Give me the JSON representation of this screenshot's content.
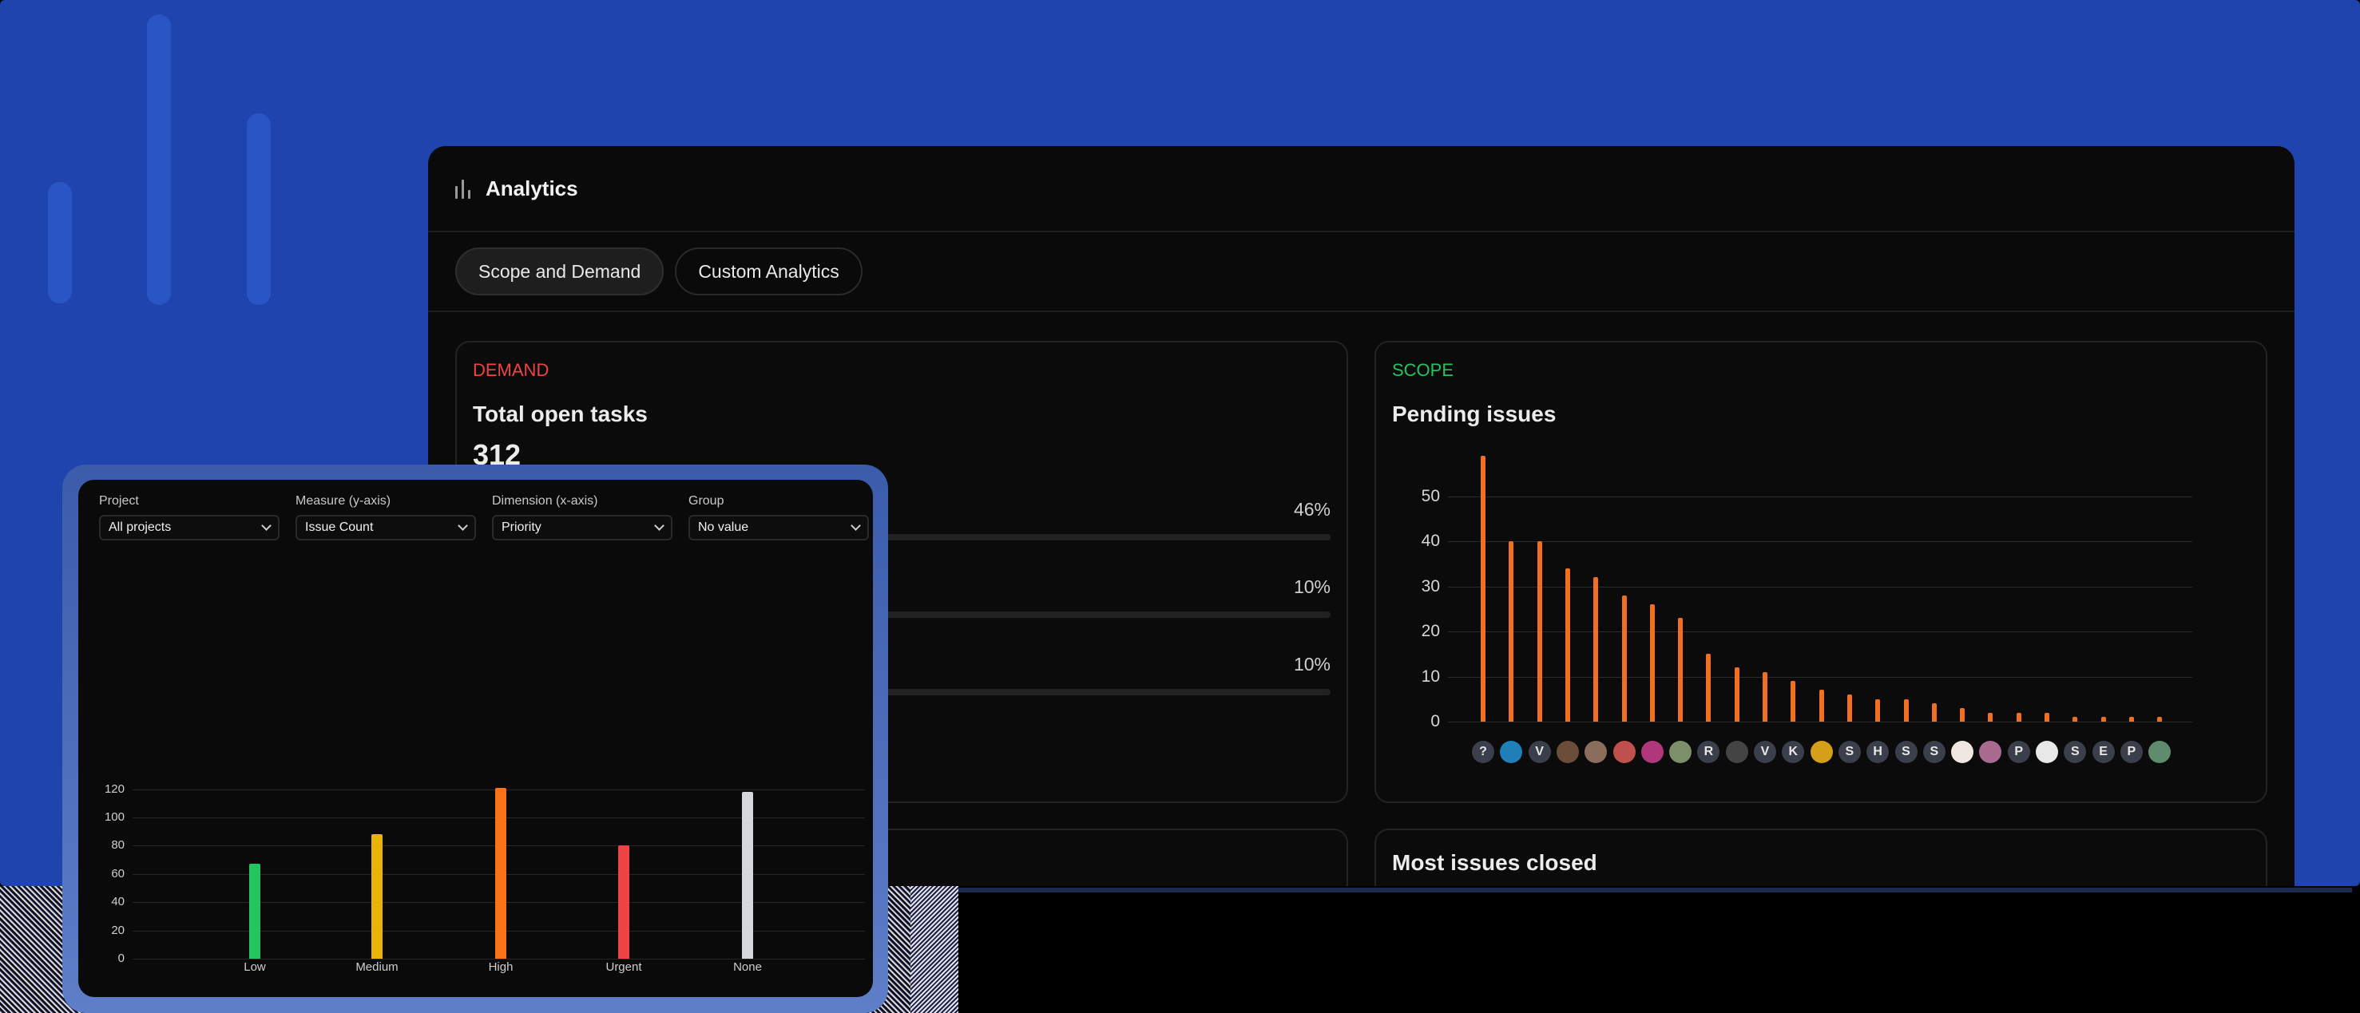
{
  "app": {
    "title": "Analytics"
  },
  "tabs": [
    {
      "label": "Scope and Demand",
      "active": true
    },
    {
      "label": "Custom Analytics",
      "active": false
    }
  ],
  "demand": {
    "tag": "DEMAND",
    "tag_color": "#ef4444",
    "title": "Total open tasks",
    "total": "312",
    "rows": [
      {
        "percent": "46%"
      },
      {
        "percent": "10%"
      },
      {
        "percent": "10%"
      }
    ]
  },
  "scope": {
    "tag": "SCOPE",
    "tag_color": "#22c55e",
    "title": "Pending issues",
    "bar_color": "#f0701f"
  },
  "closed": {
    "title": "Most issues closed"
  },
  "custom": {
    "filters": [
      {
        "label": "Project",
        "value": "All projects"
      },
      {
        "label": "Measure (y-axis)",
        "value": "Issue Count"
      },
      {
        "label": "Dimension (x-axis)",
        "value": "Priority"
      },
      {
        "label": "Group",
        "value": "No value"
      }
    ]
  },
  "chart_data": [
    {
      "type": "bar",
      "title": "Pending issues",
      "ylim": [
        0,
        55
      ],
      "yticks": [
        0,
        10,
        20,
        30,
        40,
        50
      ],
      "categories": [
        "?",
        "avatar",
        "V",
        "avatar",
        "avatar",
        "avatar",
        "avatar",
        "avatar",
        "R",
        "avatar",
        "V",
        "K",
        "avatar",
        "S",
        "H",
        "S",
        "S",
        "avatar",
        "avatar",
        "P",
        "avatar",
        "S",
        "E",
        "P",
        "avatar"
      ],
      "values": [
        59,
        40,
        40,
        34,
        32,
        28,
        26,
        23,
        15,
        12,
        11,
        9,
        7,
        6,
        5,
        5,
        4,
        3,
        2,
        2,
        2,
        1,
        1,
        1,
        1
      ],
      "avatar_colors": [
        "#3a3f4b",
        "#1f7fb8",
        "#3a3f4b",
        "#6b4e3a",
        "#8a6d5a",
        "#c0504d",
        "#b0387a",
        "#7d8f6a",
        "#3a3f4b",
        "#444444",
        "#3a3f4b",
        "#3a3f4b",
        "#d4a017",
        "#3a3f4b",
        "#3a3f4b",
        "#3a3f4b",
        "#3a3f4b",
        "#efe7e0",
        "#a86b8f",
        "#3a3f4b",
        "#e8e8e8",
        "#3a3f4b",
        "#3a3f4b",
        "#3a3f4b",
        "#5e8a6e"
      ]
    },
    {
      "type": "bar",
      "title": "",
      "xlabel": "",
      "ylabel": "",
      "ylim": [
        0,
        125
      ],
      "yticks": [
        0,
        20,
        40,
        60,
        80,
        100,
        120
      ],
      "categories": [
        "Low",
        "Medium",
        "High",
        "Urgent",
        "None"
      ],
      "values": [
        67,
        88,
        121,
        80,
        118
      ],
      "colors": [
        "#22c55e",
        "#eab308",
        "#f97316",
        "#ef4444",
        "#d4d7dc"
      ]
    }
  ]
}
